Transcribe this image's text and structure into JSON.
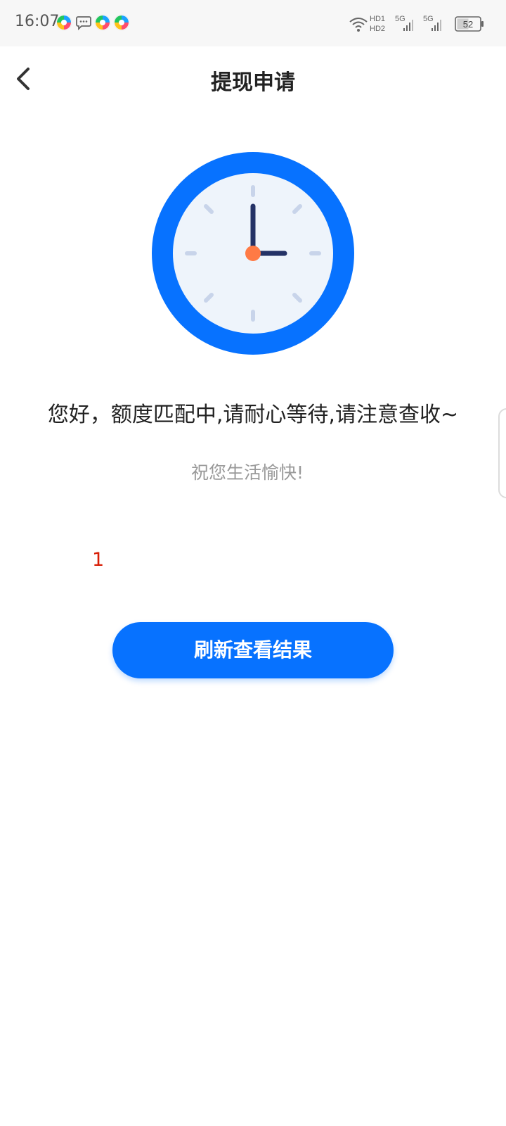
{
  "status_bar": {
    "time": "16:07",
    "network_hd1": "HD1",
    "network_hd2": "HD2",
    "sim1_type": "5G",
    "sim2_type": "5G",
    "battery_level": "52",
    "icons": [
      "app-colorful-icon",
      "message-bubble-icon",
      "app-colorful-icon",
      "app-colorful-icon",
      "wifi-icon",
      "signal-icon",
      "signal-icon",
      "battery-icon"
    ]
  },
  "nav": {
    "title": "提现申请",
    "back_icon": "chevron-left-icon"
  },
  "content": {
    "message": "您好，额度匹配中,请耐心等待,请注意查收~",
    "wish": "祝您生活愉快!",
    "count": "1",
    "refresh_label": "刷新查看结果"
  },
  "colors": {
    "primary": "#0772ff",
    "clock_face": "#eef4fb",
    "clock_hand": "#243266",
    "clock_center": "#ff7a45",
    "tick": "#c8d4ea",
    "count_red": "#d81e06"
  }
}
